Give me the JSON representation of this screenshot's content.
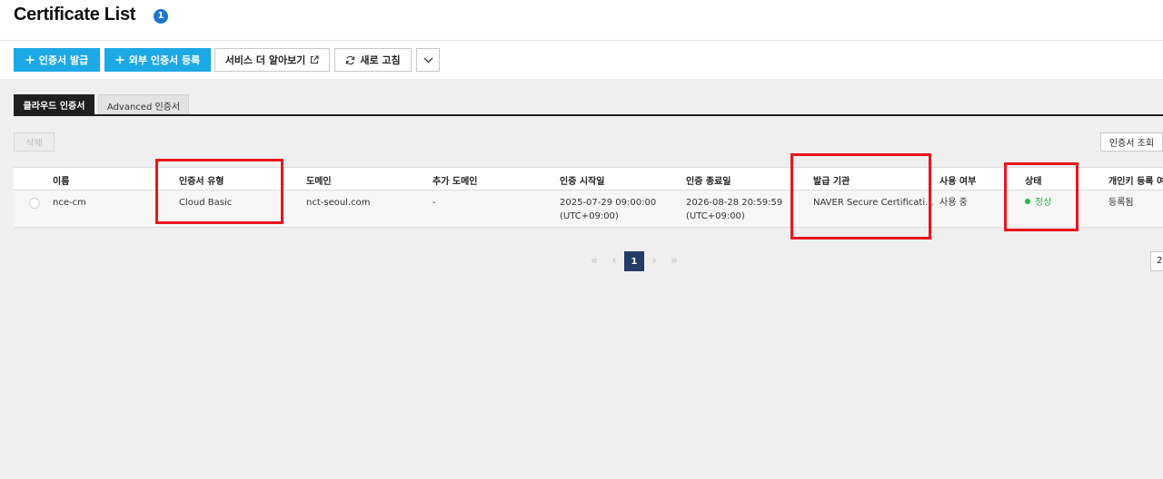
{
  "page": {
    "title": "Certificate List",
    "count_badge": "1"
  },
  "toolbar": {
    "issue_label": "인증서 발급",
    "register_external_label": "외부 인증서 등록",
    "learn_more_label": "서비스 더 알아보기",
    "refresh_label": "새로 고침"
  },
  "tabs": [
    {
      "label": "클라우드 인증서",
      "active": true
    },
    {
      "label": "Advanced 인증서",
      "active": false
    }
  ],
  "actions": {
    "delete_label": "삭제",
    "lookup_label": "인증서 조회"
  },
  "table": {
    "columns": [
      "이름",
      "인증서 유형",
      "도메인",
      "추가 도메인",
      "인증 시작일",
      "인증 종료일",
      "발급 기관",
      "사용 여부",
      "상태",
      "개인키 등록 여부"
    ],
    "rows": [
      {
        "name": "nce-cm",
        "type": "Cloud Basic",
        "domain": "nct-seoul.com",
        "extra_domain": "-",
        "start_date": "2025-07-29 09:00:00",
        "start_tz": "(UTC+09:00)",
        "end_date": "2026-08-28 20:59:59",
        "end_tz": "(UTC+09:00)",
        "issuer": "NAVER Secure Certificati...",
        "in_use": "사용 중",
        "status": "정상",
        "private_key": "등록됨"
      }
    ]
  },
  "pagination": {
    "current_page": "1",
    "page_size_partial": "2"
  },
  "colors": {
    "primary_button": "#1da8e6",
    "active_page": "#253b68",
    "status_ok": "#28b446",
    "highlight": "#e8161b",
    "title_badge": "#1d75d0"
  }
}
